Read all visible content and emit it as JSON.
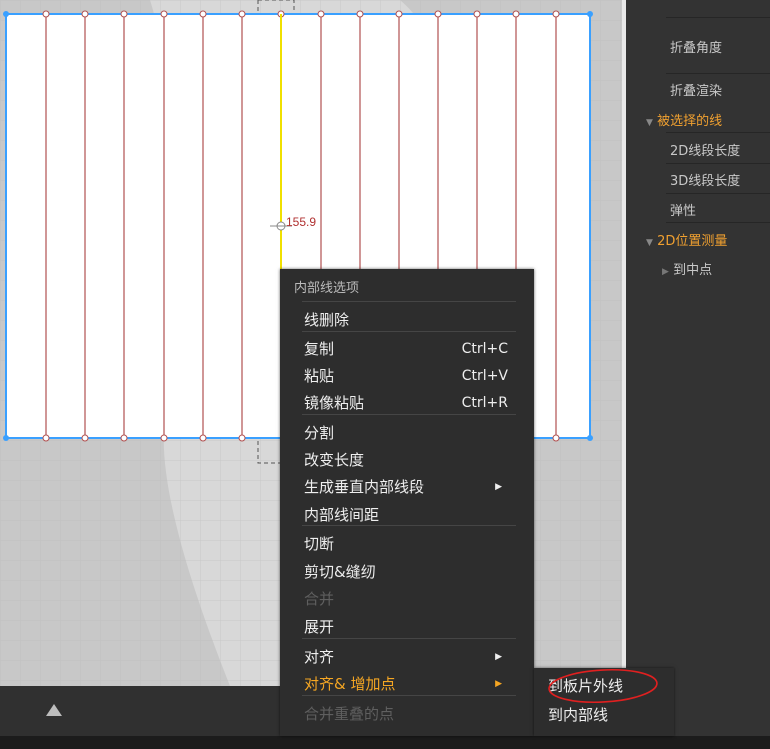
{
  "right_panel": {
    "fold_angle": "折叠角度",
    "fold_render": "折叠渲染",
    "selected_lines": "被选择的线",
    "len_2d": "2D线段长度",
    "len_3d": "3D线段长度",
    "elasticity": "弹性",
    "pos_2d": "2D位置测量",
    "to_midpoint": "到中点"
  },
  "canvas": {
    "measurement": "155.9"
  },
  "context_menu": {
    "header": "内部线选项",
    "items": [
      {
        "label": "线删除",
        "shortcut": "",
        "submenu": false,
        "disabled": false
      },
      {
        "label": "复制",
        "shortcut": "Ctrl+C",
        "submenu": false,
        "disabled": false
      },
      {
        "label": "粘贴",
        "shortcut": "Ctrl+V",
        "submenu": false,
        "disabled": false
      },
      {
        "label": "镜像粘贴",
        "shortcut": "Ctrl+R",
        "submenu": false,
        "disabled": false
      },
      {
        "label": "分割",
        "shortcut": "",
        "submenu": false,
        "disabled": false
      },
      {
        "label": "改变长度",
        "shortcut": "",
        "submenu": false,
        "disabled": false
      },
      {
        "label": "生成垂直内部线段",
        "shortcut": "",
        "submenu": true,
        "disabled": false
      },
      {
        "label": "内部线间距",
        "shortcut": "",
        "submenu": false,
        "disabled": false
      },
      {
        "label": "切断",
        "shortcut": "",
        "submenu": false,
        "disabled": false
      },
      {
        "label": "剪切&缝纫",
        "shortcut": "",
        "submenu": false,
        "disabled": false
      },
      {
        "label": "合并",
        "shortcut": "",
        "submenu": false,
        "disabled": true
      },
      {
        "label": "展开",
        "shortcut": "",
        "submenu": false,
        "disabled": false
      },
      {
        "label": "对齐",
        "shortcut": "",
        "submenu": true,
        "disabled": false
      },
      {
        "label": "对齐& 增加点",
        "shortcut": "",
        "submenu": true,
        "disabled": false,
        "highlighted": true
      },
      {
        "label": "合并重叠的点",
        "shortcut": "",
        "submenu": false,
        "disabled": true
      }
    ]
  },
  "submenu": {
    "items": [
      "到板片外线",
      "到内部线"
    ]
  },
  "colors": {
    "accent_orange": "#f5a623",
    "selection_blue": "#3aa0ff",
    "internal_line_red": "#b05050",
    "selected_line_yellow": "#f0e000",
    "annotation_red": "#e02020"
  },
  "icons": {
    "bottom_bar": "triangle-up-icon",
    "submenu_arrow": "triangle-right-icon"
  }
}
